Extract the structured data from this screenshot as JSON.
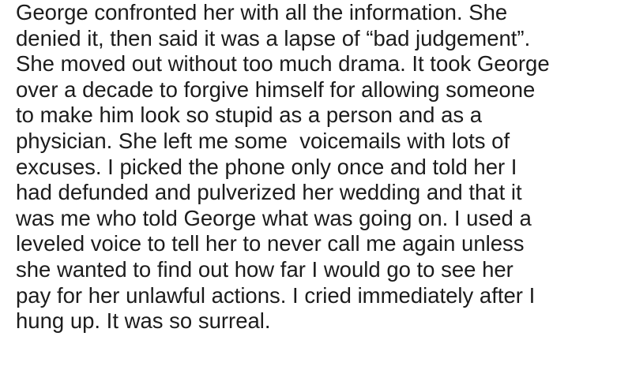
{
  "post": {
    "lines": [
      "George confronted her with all the information. She",
      "denied it, then said it was a lapse of “bad judgement”.",
      "She moved out without too much drama. It took George",
      "over a decade to forgive himself for allowing someone",
      "to make him look so stupid as a person and as a",
      "physician. She left me some  voicemails with lots of",
      "excuses. I picked the phone only once and told her I",
      "had defunded and pulverized her wedding and that it",
      "was me who told George what was going on. I used a",
      "leveled voice to tell her to never call me again unless",
      "she wanted to find out how far I would go to see her",
      "pay for her unlawful actions. I cried immediately after I",
      "hung up. It was so surreal."
    ]
  }
}
